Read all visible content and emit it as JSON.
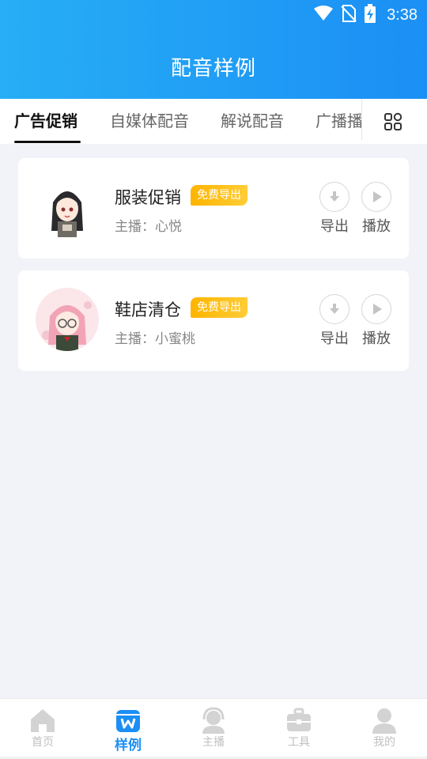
{
  "status_bar": {
    "time": "3:38"
  },
  "header": {
    "title": "配音样例"
  },
  "tabs": [
    {
      "label": "广告促销",
      "active": true
    },
    {
      "label": "自媒体配音",
      "active": false
    },
    {
      "label": "解说配音",
      "active": false
    },
    {
      "label": "广播播",
      "active": false
    }
  ],
  "tab_grid_icon": "grid-icon",
  "samples": [
    {
      "title": "服装促销",
      "badge": "免费导出",
      "anchor": "主播：心悦",
      "export_label": "导出",
      "play_label": "播放"
    },
    {
      "title": "鞋店清仓",
      "badge": "免费导出",
      "anchor": "主播：小蜜桃",
      "export_label": "导出",
      "play_label": "播放"
    }
  ],
  "bottom_nav": [
    {
      "label": "首页",
      "icon": "home-icon",
      "active": false
    },
    {
      "label": "样例",
      "icon": "shop-icon",
      "active": true
    },
    {
      "label": "主播",
      "icon": "headset-user-icon",
      "active": false
    },
    {
      "label": "工具",
      "icon": "toolbox-icon",
      "active": false
    },
    {
      "label": "我的",
      "icon": "user-icon",
      "active": false
    }
  ],
  "colors": {
    "header_start": "#27aef5",
    "header_end": "#1b8ff5",
    "badge": "#ffb400",
    "nav_active": "#1b8ff5",
    "nav_inactive": "#c0c0c0"
  }
}
